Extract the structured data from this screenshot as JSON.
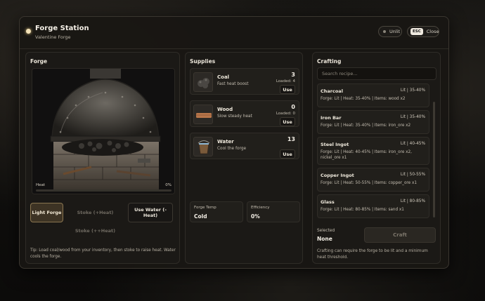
{
  "header": {
    "title": "Forge Station",
    "subtitle": "Valentine Forge",
    "status": "Unlit",
    "esc_key": "ESC",
    "close_label": "Close"
  },
  "forge": {
    "title": "Forge",
    "heat_label": "Heat",
    "heat_value": "0%",
    "heat_fraction": 0,
    "buttons": {
      "light": "Light Forge",
      "stoke": "Stoke (+Heat)",
      "water": "Use Water (-Heat)",
      "stoke_more": "Stoke (++Heat)"
    },
    "tip": "Tip: Load coal/wood from your inventory, then stoke to raise heat. Water cools the forge."
  },
  "supplies": {
    "title": "Supplies",
    "items": [
      {
        "name": "Coal",
        "desc": "Fast heat boost",
        "qty": "3",
        "loaded": "Loaded: 4",
        "use": "Use",
        "icon": "coal-icon"
      },
      {
        "name": "Wood",
        "desc": "Slow steady heat",
        "qty": "0",
        "loaded": "Loaded: 0",
        "use": "Use",
        "icon": "wood-icon"
      },
      {
        "name": "Water",
        "desc": "Cool the forge",
        "qty": "13",
        "use": "Use",
        "icon": "water-bucket-icon"
      }
    ],
    "forge_temp_label": "Forge Temp",
    "forge_temp_value": "Cold",
    "efficiency_label": "Efficiency",
    "efficiency_value": "0%"
  },
  "crafting": {
    "title": "Crafting",
    "search_placeholder": "Search recipe...",
    "recipes": [
      {
        "name": "Charcoal",
        "tag": "Lit | 35-40%",
        "detail": "Forge: Lit | Heat: 35-40% | Items: wood x2"
      },
      {
        "name": "Iron Bar",
        "tag": "Lit | 35-40%",
        "detail": "Forge: Lit | Heat: 35-40% | Items: iron_ore x2"
      },
      {
        "name": "Steel Ingot",
        "tag": "Lit | 40-45%",
        "detail": "Forge: Lit | Heat: 40-45% | Items: iron_ore x2, nickel_ore x1"
      },
      {
        "name": "Copper Ingot",
        "tag": "Lit | 50-55%",
        "detail": "Forge: Lit | Heat: 50-55% | Items: copper_ore x1"
      },
      {
        "name": "Glass",
        "tag": "Lit | 80-85%",
        "detail": "Forge: Lit | Heat: 80-85% | Items: sand x1"
      }
    ],
    "selected_label": "Selected",
    "selected_value": "None",
    "craft_button": "Craft",
    "note": "Crafting can require the forge to be lit and a minimum heat threshold."
  }
}
